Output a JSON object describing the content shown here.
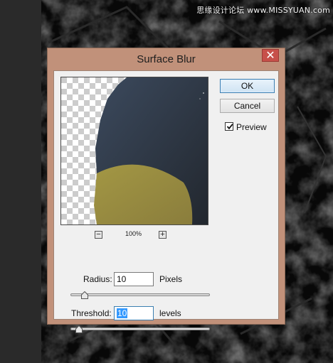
{
  "dialog": {
    "title": "Surface Blur",
    "close_glyph": "✕",
    "ok_label": "OK",
    "cancel_label": "Cancel",
    "preview_label": "Preview",
    "preview_checked": true,
    "zoom": {
      "minus": "−",
      "plus": "+",
      "level": "100%"
    },
    "radius": {
      "label": "Radius:",
      "value": "10",
      "unit": "Pixels",
      "slider_fraction": 0.08
    },
    "threshold": {
      "label": "Threshold:",
      "value": "10",
      "unit": "levels",
      "slider_fraction": 0.04
    }
  },
  "watermark": "思缘设计论坛 www.MISSYUAN.com",
  "icons": {
    "close": "close-icon",
    "check": "check-icon",
    "zoom_out": "zoom-out-icon",
    "zoom_in": "zoom-in-icon"
  },
  "colors": {
    "dialog_frame": "#c1917a",
    "close_button": "#c7504a",
    "selection": "#3399ff"
  }
}
